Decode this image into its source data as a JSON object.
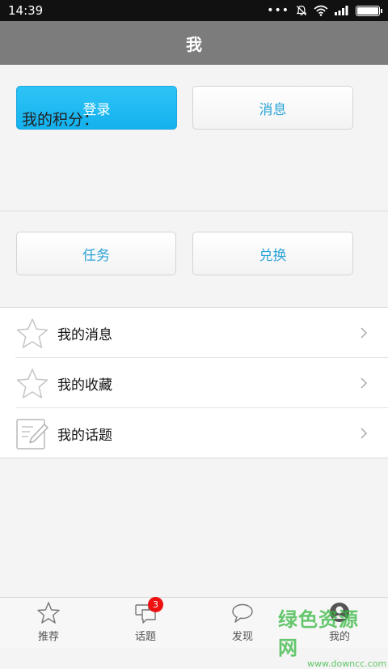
{
  "status_bar": {
    "time": "14:39",
    "icons": [
      "more-dots-icon",
      "alarm-off-icon",
      "wifi-icon",
      "signal-icon",
      "battery-icon"
    ],
    "battery_level": 1.0
  },
  "header": {
    "title": "我"
  },
  "top_actions": {
    "login_label": "登录",
    "messages_label": "消息"
  },
  "points": {
    "label": "我的积分："
  },
  "point_actions": {
    "tasks_label": "任务",
    "exchange_label": "兑换"
  },
  "menu": {
    "items": [
      {
        "label": "我的消息",
        "icon": "star-outline-icon"
      },
      {
        "label": "我的收藏",
        "icon": "star-outline-icon"
      },
      {
        "label": "我的话题",
        "icon": "edit-note-icon"
      }
    ]
  },
  "tabbar": {
    "tabs": [
      {
        "label": "推荐",
        "icon": "star-icon"
      },
      {
        "label": "话题",
        "icon": "chat-bubbles-icon",
        "badge": "3"
      },
      {
        "label": "发现",
        "icon": "speech-bubble-icon"
      },
      {
        "label": "我的",
        "icon": "user-icon"
      }
    ]
  },
  "watermark": {
    "text": "绿色资源网",
    "sub": "www.downcc.com"
  },
  "colors": {
    "accent": "#1ab3ef",
    "link_text": "#2aa3d6",
    "title_bar": "#7c7c7c",
    "badge": "#ee1111"
  }
}
